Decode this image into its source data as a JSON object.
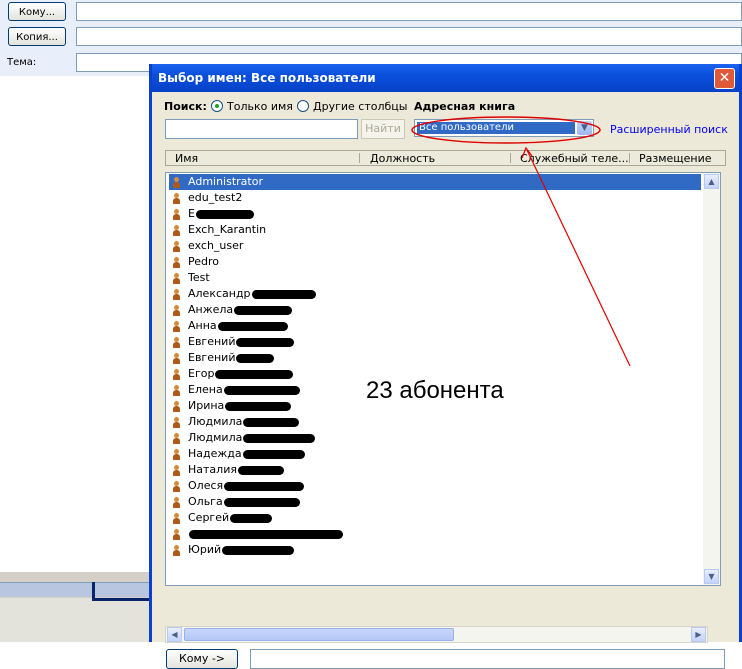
{
  "compose": {
    "to_button": "Кому...",
    "cc_button": "Копия...",
    "subject_label": "Тема:"
  },
  "dialog": {
    "title": "Выбор имен: Все пользователи",
    "close_glyph": "✕",
    "search_label": "Поиск:",
    "radio_name_only": "Только имя",
    "radio_other_columns": "Другие столбцы",
    "address_book_label": "Адресная книга",
    "find_button": "Найти",
    "address_book_value": "Все пользователи",
    "advanced_search_link": "Расширенный поиск",
    "columns": [
      "Имя",
      "Должность",
      "Служебный теле...",
      "Размещение"
    ],
    "names": [
      "Administrator",
      "edu_test2",
      "Е",
      "Exch_Karantin",
      "exch_user",
      "Pedro",
      "Test",
      "Александр",
      "Анжела",
      "Анна",
      "Евгений",
      "Евгений",
      "Егор",
      "Елена",
      "Ирина",
      "Людмила",
      "Людмила",
      "Надежда",
      "Наталия",
      "Олеся",
      "Ольга",
      "Сергей",
      "",
      "Юрий"
    ],
    "to_button": "Кому ->"
  },
  "annotation": "23 абонента",
  "colors": {
    "selection": "#316ac5",
    "titlebar": "#0a4fdc",
    "annotation_stroke": "#e00000"
  }
}
